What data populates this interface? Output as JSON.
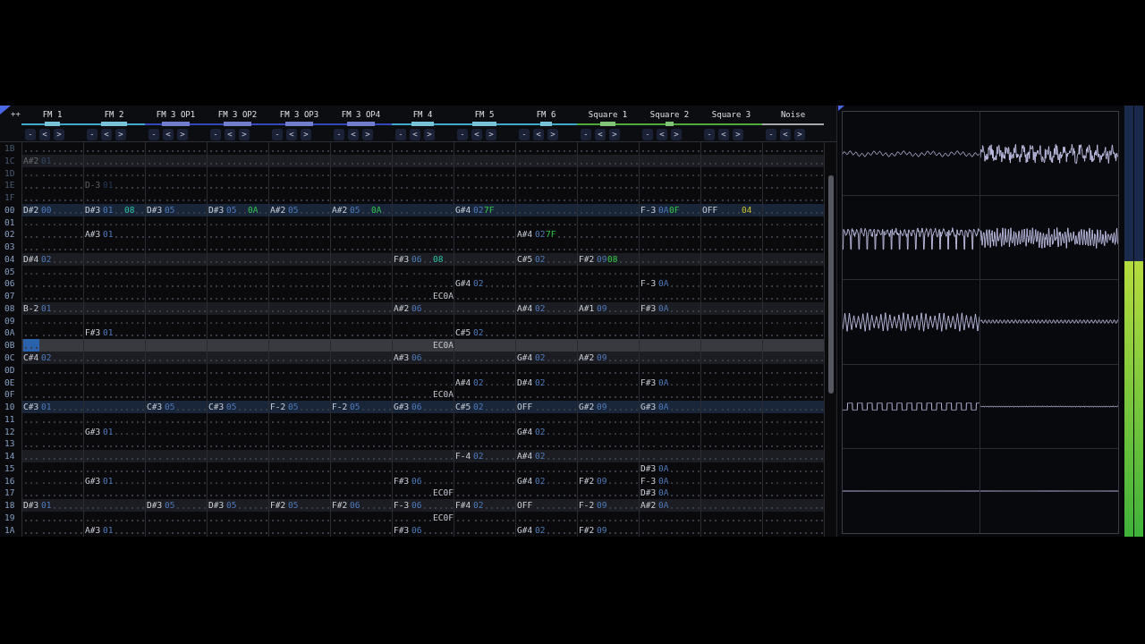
{
  "pattern": {
    "corner_button": "++",
    "channels": [
      {
        "name": "FM 1",
        "color": "#3fa9c9",
        "meters": [
          {
            "level": 0.25
          },
          {
            "level": 0.25
          }
        ],
        "buttons": [
          "-",
          "<",
          ">"
        ]
      },
      {
        "name": "FM 2",
        "color": "#3fa9c9",
        "meters": [
          {
            "level": 0.42
          },
          {
            "level": 0.42
          }
        ],
        "buttons": [
          "-",
          "<",
          ">"
        ]
      },
      {
        "name": "FM 3 OP1",
        "color": "#3448b8",
        "meters": [
          {
            "level": 0.45
          },
          {
            "level": 0.45
          }
        ],
        "buttons": [
          "-",
          "<",
          ">"
        ]
      },
      {
        "name": "FM 3 OP2",
        "color": "#3448b8",
        "meters": [
          {
            "level": 0.46
          },
          {
            "level": 0.46
          }
        ],
        "buttons": [
          "-",
          "<",
          ">"
        ]
      },
      {
        "name": "FM 3 OP3",
        "color": "#3448b8",
        "meters": [
          {
            "level": 0.45
          },
          {
            "level": 0.45
          }
        ],
        "buttons": [
          "-",
          "<",
          ">"
        ]
      },
      {
        "name": "FM 3 OP4",
        "color": "#3448b8",
        "meters": [
          {
            "level": 0.45
          },
          {
            "level": 0.45
          }
        ],
        "buttons": [
          "-",
          "<",
          ">"
        ]
      },
      {
        "name": "FM 4",
        "color": "#3fa9c9",
        "meters": [
          {
            "level": 0.36
          },
          {
            "level": 0.36
          }
        ],
        "buttons": [
          "-",
          "<",
          ">"
        ]
      },
      {
        "name": "FM 5",
        "color": "#3fa9c9",
        "meters": [
          {
            "level": 0.39
          },
          {
            "level": 0.39
          }
        ],
        "buttons": [
          "-",
          "<",
          ">"
        ]
      },
      {
        "name": "FM 6",
        "color": "#3fa9c9",
        "meters": [
          {
            "level": 0.2
          },
          {
            "level": 0.2
          }
        ],
        "buttons": [
          "-",
          "<",
          ">"
        ]
      },
      {
        "name": "Square 1",
        "color": "#4caa3c",
        "meters": [
          {
            "level": 0.25
          },
          {
            "level": 0.25
          }
        ],
        "buttons": [
          "-",
          "<",
          ">"
        ]
      },
      {
        "name": "Square 2",
        "color": "#4caa3c",
        "meters": [
          {
            "level": 0.14
          },
          {
            "level": 0.14
          }
        ],
        "buttons": [
          "-",
          "<",
          ">"
        ]
      },
      {
        "name": "Square 3",
        "color": "#4caa3c",
        "buttons": [
          "-",
          "<",
          ">"
        ]
      },
      {
        "name": "Noise",
        "color": "#a8a8ac",
        "buttons": [
          "-",
          "<",
          ">"
        ]
      }
    ],
    "rows": [
      {
        "number": "1B",
        "highlighted": false,
        "measure": false,
        "playing": false,
        "faded": true,
        "cells": [
          {},
          {},
          {},
          {},
          {},
          {},
          {},
          {},
          {},
          {},
          {},
          {},
          {}
        ]
      },
      {
        "number": "1C",
        "highlighted": true,
        "measure": false,
        "playing": false,
        "faded": true,
        "cells": [
          {
            "note": "A#2",
            "ins": "01"
          },
          {},
          {},
          {},
          {},
          {},
          {},
          {},
          {},
          {},
          {},
          {},
          {}
        ]
      },
      {
        "number": "1D",
        "highlighted": false,
        "measure": false,
        "playing": false,
        "faded": true,
        "cells": [
          {},
          {},
          {},
          {},
          {},
          {},
          {},
          {},
          {},
          {},
          {},
          {},
          {}
        ]
      },
      {
        "number": "1E",
        "highlighted": false,
        "measure": false,
        "playing": false,
        "faded": true,
        "cells": [
          {},
          {
            "note": "D-3",
            "ins": "01"
          },
          {},
          {},
          {},
          {},
          {},
          {},
          {},
          {},
          {},
          {},
          {}
        ]
      },
      {
        "number": "1F",
        "highlighted": false,
        "measure": false,
        "playing": false,
        "faded": true,
        "cells": [
          {},
          {},
          {},
          {},
          {},
          {},
          {},
          {},
          {},
          {},
          {},
          {},
          {}
        ]
      },
      {
        "number": "00",
        "highlighted": true,
        "measure": true,
        "playing": false,
        "faded": false,
        "cells": [
          {
            "note": "D#2",
            "ins": "00"
          },
          {
            "note": "D#3",
            "ins": "01",
            "fx": {
              "text": "08",
              "kind": "panning"
            }
          },
          {
            "note": "D#3",
            "ins": "05"
          },
          {
            "note": "D#3",
            "ins": "05",
            "fx": {
              "text": "0A",
              "kind": "volume"
            }
          },
          {
            "note": "A#2",
            "ins": "05"
          },
          {
            "note": "A#2",
            "ins": "05",
            "fx": {
              "text": "0A",
              "kind": "volume"
            }
          },
          {},
          {
            "note": "G#4",
            "ins": "02",
            "vol": "7F"
          },
          {},
          {},
          {
            "note": "F-3",
            "ins": "0A",
            "vol": "0F"
          },
          {
            "note": "OFF",
            "fx": {
              "text": "04",
              "kind": "pitch"
            }
          },
          {}
        ]
      },
      {
        "number": "01",
        "highlighted": false,
        "measure": false,
        "playing": false,
        "faded": false,
        "cells": [
          {},
          {},
          {},
          {},
          {},
          {},
          {},
          {},
          {},
          {},
          {},
          {},
          {}
        ]
      },
      {
        "number": "02",
        "highlighted": false,
        "measure": false,
        "playing": false,
        "faded": false,
        "cells": [
          {},
          {
            "note": "A#3",
            "ins": "01"
          },
          {},
          {},
          {},
          {},
          {},
          {},
          {
            "note": "A#4",
            "ins": "02",
            "vol": "7F"
          },
          {},
          {},
          {},
          {}
        ]
      },
      {
        "number": "03",
        "highlighted": false,
        "measure": false,
        "playing": false,
        "faded": false,
        "cells": [
          {},
          {},
          {},
          {},
          {},
          {},
          {},
          {},
          {},
          {},
          {},
          {},
          {}
        ]
      },
      {
        "number": "04",
        "highlighted": true,
        "measure": false,
        "playing": false,
        "faded": false,
        "cells": [
          {
            "note": "D#4",
            "ins": "02"
          },
          {},
          {},
          {},
          {},
          {},
          {
            "note": "F#3",
            "ins": "06",
            "fx": {
              "text": "08",
              "kind": "panning"
            }
          },
          {},
          {
            "note": "C#5",
            "ins": "02"
          },
          {
            "note": "F#2",
            "ins": "09",
            "vol": "08"
          },
          {},
          {},
          {}
        ]
      },
      {
        "number": "05",
        "highlighted": false,
        "measure": false,
        "playing": false,
        "faded": false,
        "cells": [
          {},
          {},
          {},
          {},
          {},
          {},
          {},
          {},
          {},
          {},
          {},
          {},
          {}
        ]
      },
      {
        "number": "06",
        "highlighted": false,
        "measure": false,
        "playing": false,
        "faded": false,
        "cells": [
          {},
          {},
          {},
          {},
          {},
          {},
          {},
          {
            "note": "G#4",
            "ins": "02"
          },
          {},
          {},
          {
            "note": "F-3",
            "ins": "0A"
          },
          {},
          {}
        ]
      },
      {
        "number": "07",
        "highlighted": false,
        "measure": false,
        "playing": false,
        "faded": false,
        "cells": [
          {},
          {},
          {},
          {},
          {},
          {},
          {
            "fx": {
              "text": "EC0A",
              "kind": "misc"
            }
          },
          {},
          {},
          {},
          {},
          {},
          {}
        ]
      },
      {
        "number": "08",
        "highlighted": true,
        "measure": false,
        "playing": false,
        "faded": false,
        "cells": [
          {
            "note": "B-2",
            "ins": "01"
          },
          {},
          {},
          {},
          {},
          {},
          {
            "note": "A#2",
            "ins": "06"
          },
          {},
          {
            "note": "A#4",
            "ins": "02"
          },
          {
            "note": "A#1",
            "ins": "09"
          },
          {
            "note": "F#3",
            "ins": "0A"
          },
          {},
          {}
        ]
      },
      {
        "number": "09",
        "highlighted": false,
        "measure": false,
        "playing": false,
        "faded": false,
        "cells": [
          {},
          {},
          {},
          {},
          {},
          {},
          {},
          {},
          {},
          {},
          {},
          {},
          {}
        ]
      },
      {
        "number": "0A",
        "highlighted": false,
        "measure": false,
        "playing": false,
        "faded": false,
        "cells": [
          {},
          {
            "note": "F#3",
            "ins": "01"
          },
          {},
          {},
          {},
          {},
          {},
          {
            "note": "C#5",
            "ins": "02"
          },
          {},
          {},
          {},
          {},
          {}
        ]
      },
      {
        "number": "0B",
        "highlighted": false,
        "measure": false,
        "playing": true,
        "faded": false,
        "cells": [
          {
            "cursor": true
          },
          {},
          {},
          {},
          {},
          {},
          {
            "fx": {
              "text": "EC0A",
              "kind": "misc"
            }
          },
          {},
          {},
          {},
          {},
          {},
          {}
        ]
      },
      {
        "number": "0C",
        "highlighted": true,
        "measure": false,
        "playing": false,
        "faded": false,
        "cells": [
          {
            "note": "C#4",
            "ins": "02"
          },
          {},
          {},
          {},
          {},
          {},
          {
            "note": "A#3",
            "ins": "06"
          },
          {},
          {
            "note": "G#4",
            "ins": "02"
          },
          {
            "note": "A#2",
            "ins": "09"
          },
          {},
          {},
          {}
        ]
      },
      {
        "number": "0D",
        "highlighted": false,
        "measure": false,
        "playing": false,
        "faded": false,
        "cells": [
          {},
          {},
          {},
          {},
          {},
          {},
          {},
          {},
          {},
          {},
          {},
          {},
          {}
        ]
      },
      {
        "number": "0E",
        "highlighted": false,
        "measure": false,
        "playing": false,
        "faded": false,
        "cells": [
          {},
          {},
          {},
          {},
          {},
          {},
          {},
          {
            "note": "A#4",
            "ins": "02"
          },
          {
            "note": "D#4",
            "ins": "02"
          },
          {},
          {
            "note": "F#3",
            "ins": "0A"
          },
          {},
          {}
        ]
      },
      {
        "number": "0F",
        "highlighted": false,
        "measure": false,
        "playing": false,
        "faded": false,
        "cells": [
          {},
          {},
          {},
          {},
          {},
          {},
          {
            "fx": {
              "text": "EC0A",
              "kind": "misc"
            }
          },
          {},
          {},
          {},
          {},
          {},
          {}
        ]
      },
      {
        "number": "10",
        "highlighted": true,
        "measure": true,
        "playing": false,
        "faded": false,
        "cells": [
          {
            "note": "C#3",
            "ins": "01"
          },
          {},
          {
            "note": "C#3",
            "ins": "05"
          },
          {
            "note": "C#3",
            "ins": "05"
          },
          {
            "note": "F-2",
            "ins": "05"
          },
          {
            "note": "F-2",
            "ins": "05"
          },
          {
            "note": "G#3",
            "ins": "06"
          },
          {
            "note": "C#5",
            "ins": "02"
          },
          {
            "note": "OFF"
          },
          {
            "note": "G#2",
            "ins": "09"
          },
          {
            "note": "G#3",
            "ins": "0A"
          },
          {},
          {}
        ]
      },
      {
        "number": "11",
        "highlighted": false,
        "measure": false,
        "playing": false,
        "faded": false,
        "cells": [
          {},
          {},
          {},
          {},
          {},
          {},
          {},
          {},
          {},
          {},
          {},
          {},
          {}
        ]
      },
      {
        "number": "12",
        "highlighted": false,
        "measure": false,
        "playing": false,
        "faded": false,
        "cells": [
          {},
          {
            "note": "G#3",
            "ins": "01"
          },
          {},
          {},
          {},
          {},
          {},
          {},
          {
            "note": "G#4",
            "ins": "02"
          },
          {},
          {},
          {},
          {}
        ]
      },
      {
        "number": "13",
        "highlighted": false,
        "measure": false,
        "playing": false,
        "faded": false,
        "cells": [
          {},
          {},
          {},
          {},
          {},
          {},
          {},
          {},
          {},
          {},
          {},
          {},
          {}
        ]
      },
      {
        "number": "14",
        "highlighted": true,
        "measure": false,
        "playing": false,
        "faded": false,
        "cells": [
          {},
          {},
          {},
          {},
          {},
          {},
          {},
          {
            "note": "F-4",
            "ins": "02"
          },
          {
            "note": "A#4",
            "ins": "02"
          },
          {},
          {},
          {},
          {}
        ]
      },
      {
        "number": "15",
        "highlighted": false,
        "measure": false,
        "playing": false,
        "faded": false,
        "cells": [
          {},
          {},
          {},
          {},
          {},
          {},
          {},
          {},
          {},
          {},
          {
            "note": "D#3",
            "ins": "0A"
          },
          {},
          {}
        ]
      },
      {
        "number": "16",
        "highlighted": false,
        "measure": false,
        "playing": false,
        "faded": false,
        "cells": [
          {},
          {
            "note": "G#3",
            "ins": "01"
          },
          {},
          {},
          {},
          {},
          {
            "note": "F#3",
            "ins": "06"
          },
          {},
          {
            "note": "G#4",
            "ins": "02"
          },
          {
            "note": "F#2",
            "ins": "09"
          },
          {
            "note": "F-3",
            "ins": "0A"
          },
          {},
          {}
        ]
      },
      {
        "number": "17",
        "highlighted": false,
        "measure": false,
        "playing": false,
        "faded": false,
        "cells": [
          {},
          {},
          {},
          {},
          {},
          {},
          {
            "fx": {
              "text": "EC0F",
              "kind": "misc"
            }
          },
          {},
          {},
          {},
          {
            "note": "D#3",
            "ins": "0A"
          },
          {},
          {}
        ]
      },
      {
        "number": "18",
        "highlighted": true,
        "measure": false,
        "playing": false,
        "faded": false,
        "cells": [
          {
            "note": "D#3",
            "ins": "01"
          },
          {},
          {
            "note": "D#3",
            "ins": "05"
          },
          {
            "note": "D#3",
            "ins": "05"
          },
          {
            "note": "F#2",
            "ins": "05"
          },
          {
            "note": "F#2",
            "ins": "06"
          },
          {
            "note": "F-3",
            "ins": "06"
          },
          {
            "note": "F#4",
            "ins": "02"
          },
          {
            "note": "OFF"
          },
          {
            "note": "F-2",
            "ins": "09"
          },
          {
            "note": "A#2",
            "ins": "0A"
          },
          {},
          {}
        ]
      },
      {
        "number": "19",
        "highlighted": false,
        "measure": false,
        "playing": false,
        "faded": false,
        "cells": [
          {},
          {},
          {},
          {},
          {},
          {},
          {
            "fx": {
              "text": "EC0F",
              "kind": "misc"
            }
          },
          {},
          {},
          {},
          {},
          {},
          {}
        ]
      },
      {
        "number": "1A",
        "highlighted": false,
        "measure": false,
        "playing": false,
        "faded": false,
        "cells": [
          {},
          {
            "note": "A#3",
            "ins": "01"
          },
          {},
          {},
          {},
          {},
          {
            "note": "F#3",
            "ins": "06"
          },
          {},
          {
            "note": "G#4",
            "ins": "02"
          },
          {
            "note": "F#2",
            "ins": "09"
          },
          {},
          {},
          {}
        ]
      }
    ]
  },
  "oscilloscope": {
    "scopes": [
      {
        "kind": "braid"
      },
      {
        "kind": "noise"
      },
      {
        "kind": "spikes"
      },
      {
        "kind": "dense"
      },
      {
        "kind": "saw"
      },
      {
        "kind": "ripple"
      },
      {
        "kind": "square"
      },
      {
        "kind": "hum"
      },
      {
        "kind": "flat"
      },
      {
        "kind": "flat"
      }
    ]
  },
  "master_meter": [
    {
      "level": 0.64
    },
    {
      "level": 0.64
    }
  ]
}
